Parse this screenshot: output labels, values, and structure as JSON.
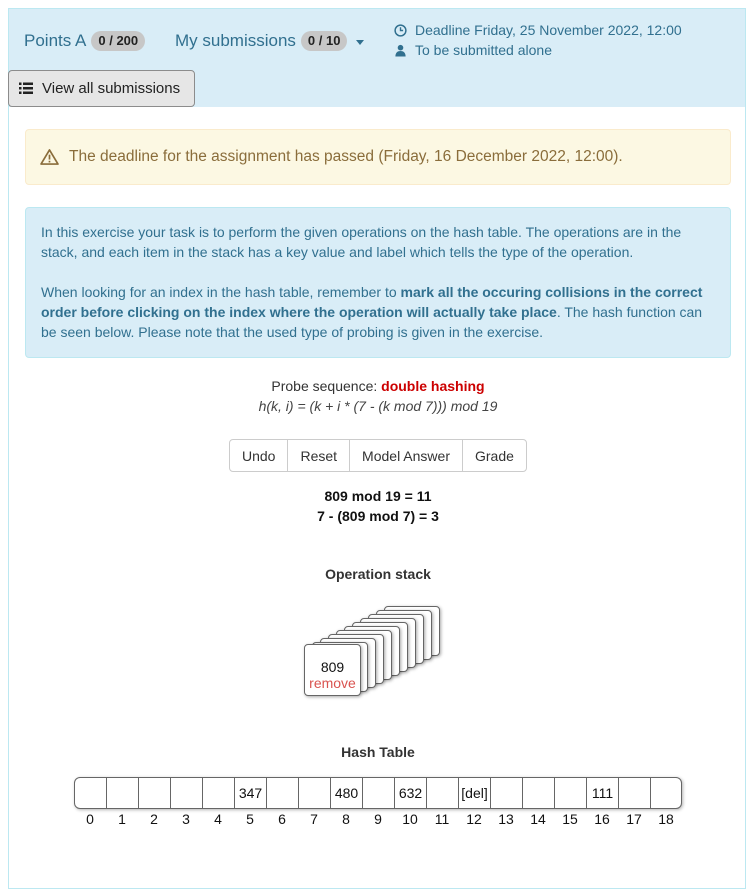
{
  "header": {
    "points_label": "Points A",
    "points_badge": "0 / 200",
    "submissions_label": "My submissions",
    "submissions_badge": "0 / 10",
    "deadline": "Deadline Friday, 25 November 2022, 12:00",
    "submission_mode": "To be submitted alone",
    "view_all_label": "View all submissions"
  },
  "alerts": {
    "warning": "The deadline for the assignment has passed (Friday, 16 December 2022, 12:00).",
    "info_p1": "In this exercise your task is to perform the given operations on the hash table. The operations are in the stack, and each item in the stack has a key value and label which tells the type of the operation.",
    "info_p2_before": "When looking for an index in the hash table, remember to ",
    "info_p2_bold": "mark all the occuring collisions in the correct order before clicking on the index where the operation will actually take place",
    "info_p2_after": ". The hash function can be seen below. Please note that the used type of probing is given in the exercise."
  },
  "exercise": {
    "probe_label": "Probe sequence: ",
    "probe_method": "double hashing",
    "formula": "h(k, i) = (k + i * (7 - (k mod 7))) mod 19",
    "buttons": {
      "undo": "Undo",
      "reset": "Reset",
      "model_answer": "Model Answer",
      "grade": "Grade"
    },
    "calc1": "809 mod 19 = 11",
    "calc2": "7 - (809 mod 7) = 3",
    "stack_title": "Operation stack",
    "top_item": {
      "key": "809",
      "label": "remove"
    },
    "table_title": "Hash Table",
    "cells": [
      "",
      "",
      "",
      "",
      "",
      "347",
      "",
      "",
      "480",
      "",
      "632",
      "",
      "[del]",
      "",
      "",
      "",
      "111",
      "",
      ""
    ],
    "indices": [
      "0",
      "1",
      "2",
      "3",
      "4",
      "5",
      "6",
      "7",
      "8",
      "9",
      "10",
      "11",
      "12",
      "13",
      "14",
      "15",
      "16",
      "17",
      "18"
    ]
  },
  "colors": {
    "header_bg": "#d9edf7",
    "info_text": "#31708f",
    "warning_bg": "#fcf8e3",
    "warning_text": "#8a6d3b",
    "probe_method": "#cc0000",
    "remove_label": "#d9534f"
  },
  "icons": [
    "clock-icon",
    "user-icon",
    "list-icon",
    "warning-icon"
  ]
}
